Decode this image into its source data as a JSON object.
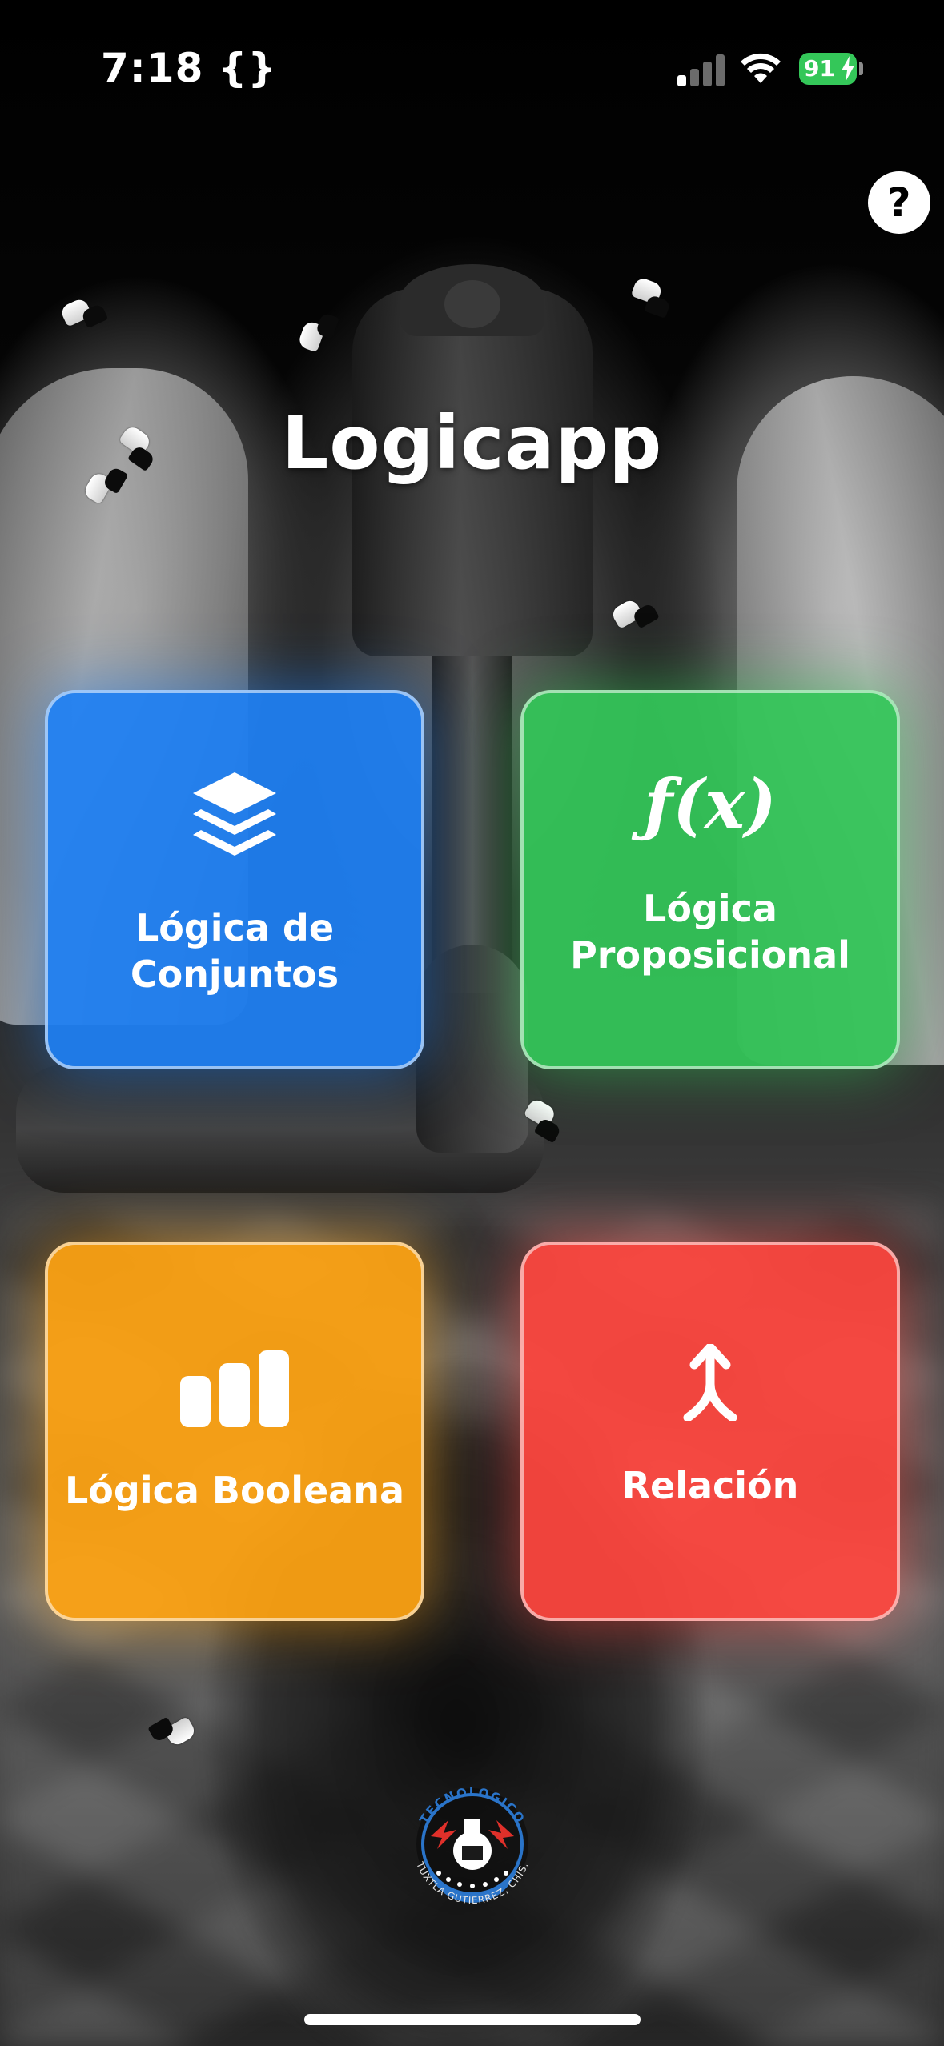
{
  "status_bar": {
    "time": "7:18",
    "time_suffix": "{}",
    "battery_level": "91",
    "battery_color": "#34c759"
  },
  "help": {
    "label": "?"
  },
  "app": {
    "title": "Logicapp"
  },
  "cards": [
    {
      "label_line1": "Lógica de",
      "label_line2": "Conjuntos",
      "icon": "layers-icon",
      "color": "#1e80f4"
    },
    {
      "label_line1": "Lógica",
      "label_line2": "Proposicional",
      "icon": "function-icon",
      "icon_text": "ƒ(x)",
      "color": "#34c759"
    },
    {
      "label": "Lógica Booleana",
      "icon": "bar-chart-icon",
      "color": "#ffa412"
    },
    {
      "label": "Relación",
      "icon": "merge-arrow-icon",
      "color": "#ff463e"
    }
  ],
  "logo": {
    "top_text": "TECNOLOGICO",
    "bottom_text": "TUXTLA GUTIERREZ, CHIS."
  }
}
